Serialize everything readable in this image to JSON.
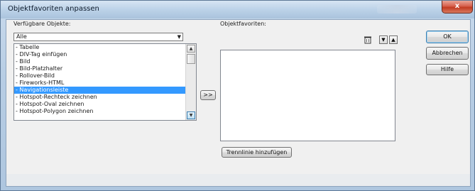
{
  "window": {
    "title": "Objektfavoriten anpassen",
    "close_glyph": "x"
  },
  "available": {
    "label": "Verfügbare Objekte:",
    "combo_value": "Alle",
    "combo_arrow": "▼",
    "items": [
      "- Tabelle",
      "- DIV-Tag einfügen",
      "- Bild",
      "- Bild-Platzhalter",
      "- Rollover-Bild",
      "- Fireworks-HTML",
      "- Navigationsleiste",
      "- Hotspot-Rechteck zeichnen",
      "- Hotspot-Oval zeichnen",
      "- Hotspot-Polygon zeichnen"
    ],
    "selected_index": 6,
    "scroll_up": "▲",
    "scroll_down": "▼"
  },
  "add_button": ">>",
  "favorites": {
    "label": "Objektfavoriten:",
    "delete_icon": "trash-icon",
    "move_down": "▼",
    "move_up": "▲",
    "separator_button": "Trennlinie hinzufügen"
  },
  "buttons": {
    "ok": "OK",
    "cancel": "Abbrechen",
    "help": "Hilfe"
  },
  "colors": {
    "selection": "#3399ff",
    "title_gradient": "#bcd2e8",
    "close_red": "#c23b22"
  }
}
